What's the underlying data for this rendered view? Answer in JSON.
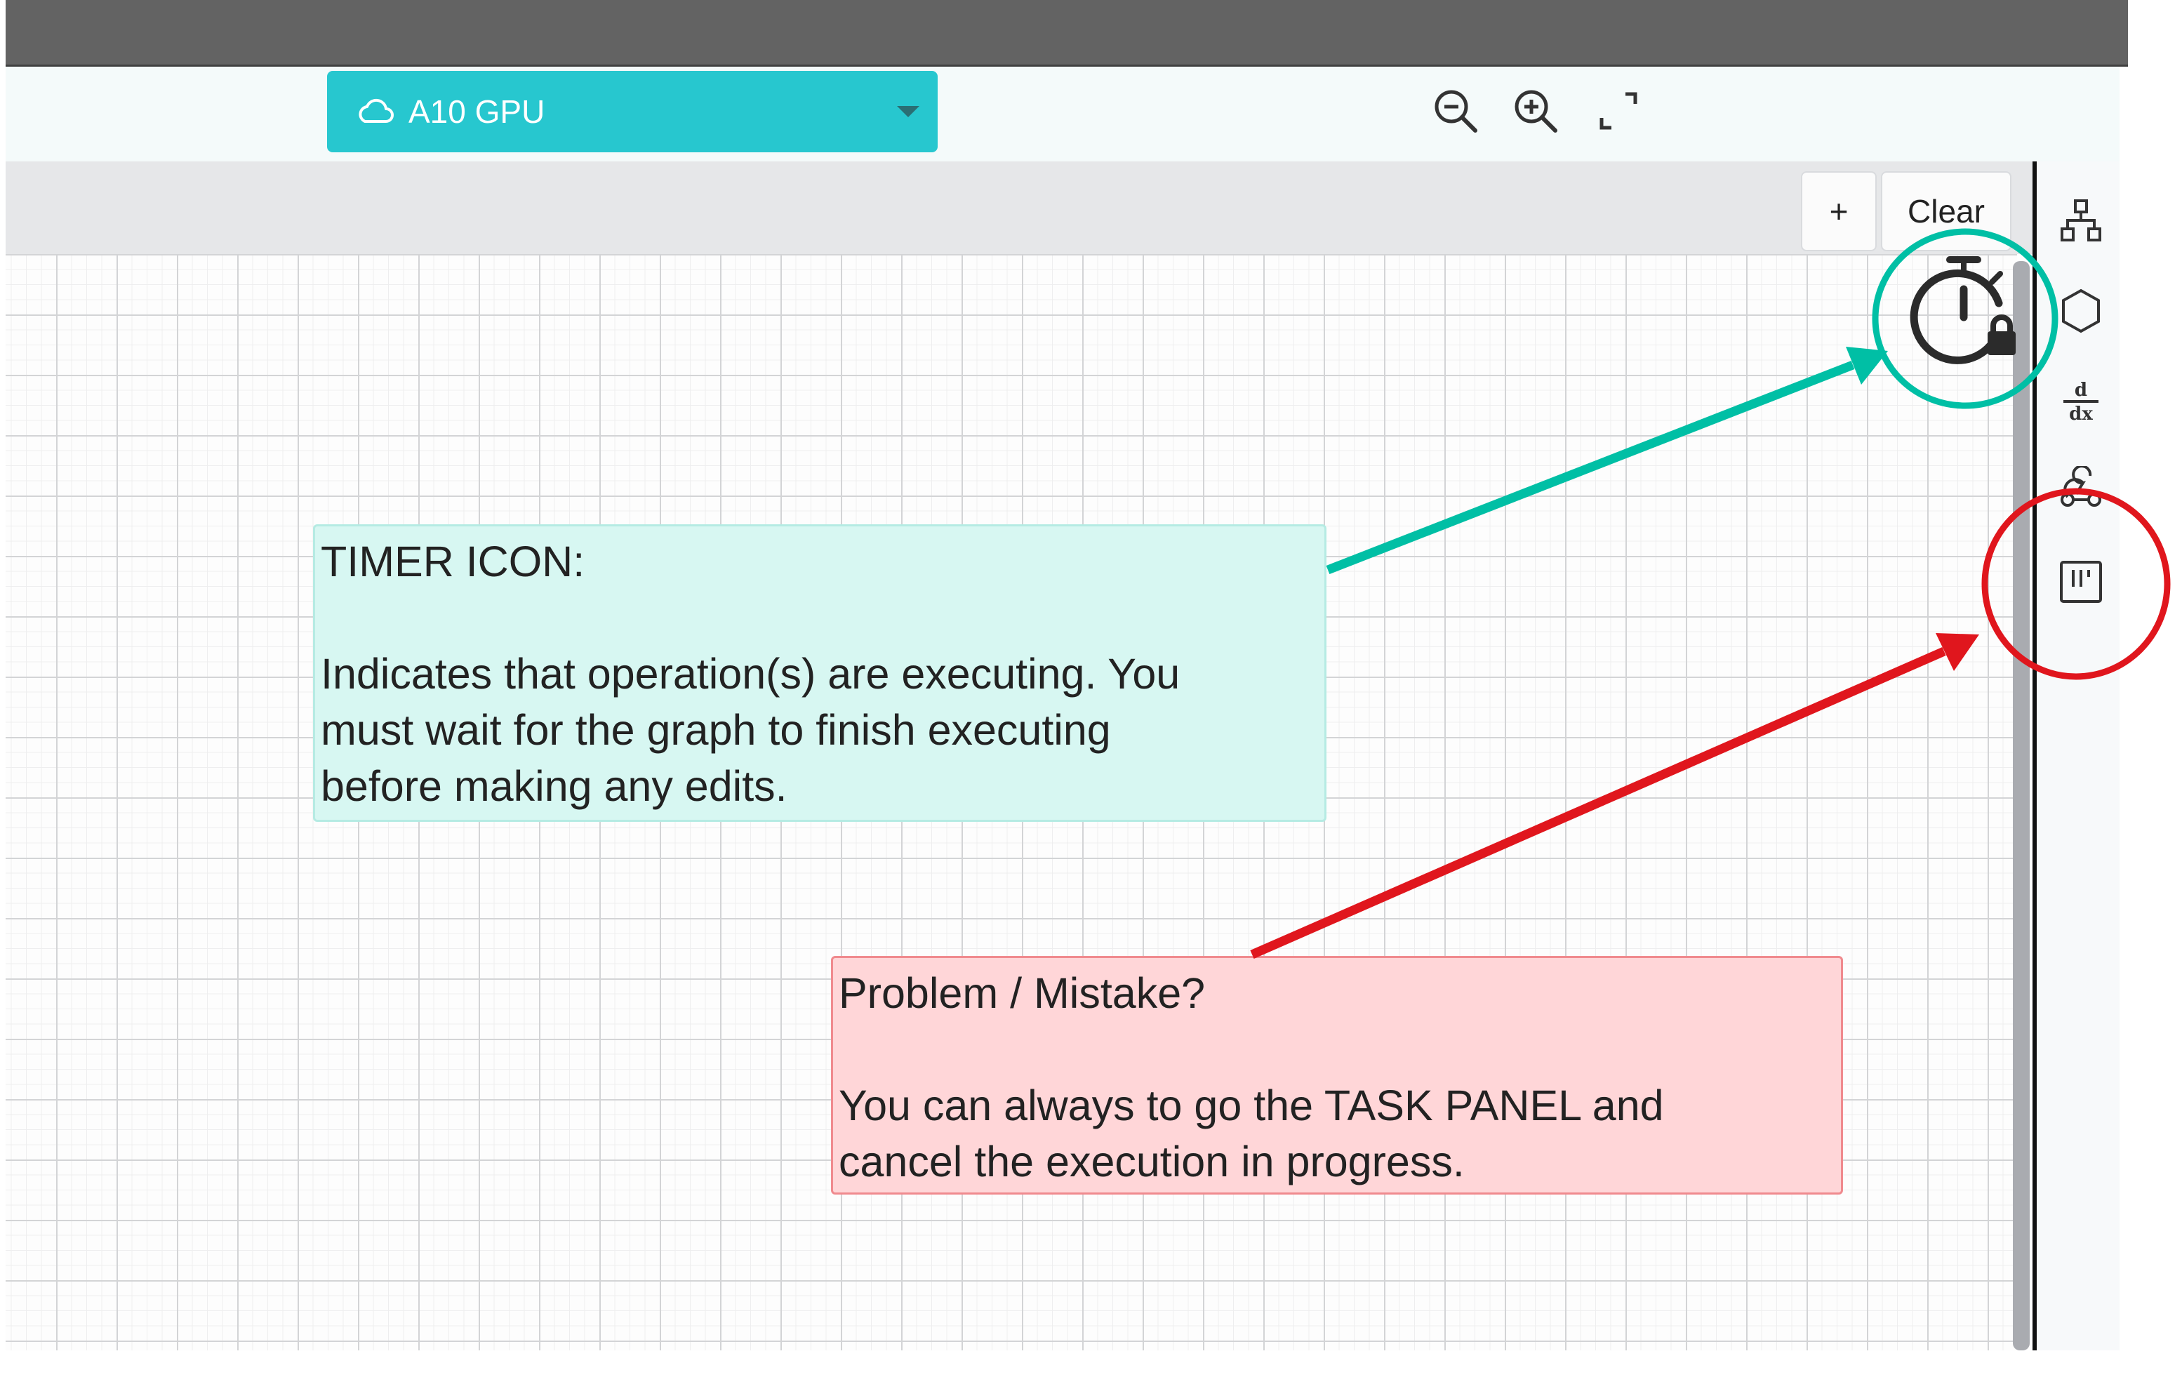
{
  "toolbar": {
    "instance_label": "A10 GPU",
    "instance_icon": "cloud-icon",
    "zoom_out_icon": "zoom-out-icon",
    "zoom_in_icon": "zoom-in-icon",
    "fit_icon": "fit-screen-icon"
  },
  "canvas": {
    "add_button": "+",
    "clear_button": "Clear",
    "status_icon": "timer-lock-icon"
  },
  "sidebar": {
    "icons": [
      "graph-icon",
      "hexagon-icon",
      "derivative-icon",
      "webhook-icon",
      "task-panel-icon"
    ],
    "derivative_top": "d",
    "derivative_bottom": "dx"
  },
  "annotations": {
    "timer": {
      "heading": "TIMER ICON:",
      "line1": "Indicates that operation(s) are executing. You",
      "line2": "must wait for the graph to finish executing",
      "line3": "before making any edits."
    },
    "problem": {
      "heading": "Problem / Mistake?",
      "line1": "You can always to go the TASK PANEL and",
      "line2": "cancel the execution in progress."
    }
  },
  "colors": {
    "accent": "#27c7cf",
    "teal_annotation": "#00bfa5",
    "red_annotation": "#e0161d",
    "top_bar": "#636363"
  }
}
